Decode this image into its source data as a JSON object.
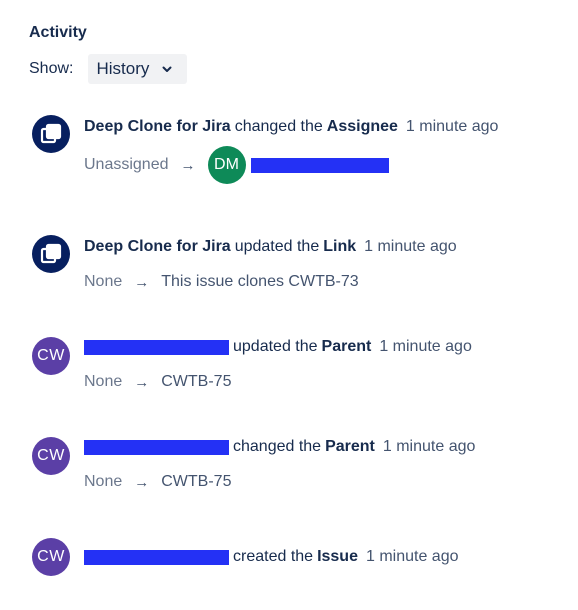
{
  "activity": {
    "heading": "Activity",
    "show_label": "Show:",
    "filter_value": "History"
  },
  "entries": [
    {
      "actor": "Deep Clone for Jira",
      "verb": "changed the",
      "field": "Assignee",
      "time": "1 minute ago",
      "from": "Unassigned",
      "to_avatar": "DM"
    },
    {
      "actor": "Deep Clone for Jira",
      "verb": "updated the",
      "field": "Link",
      "time": "1 minute ago",
      "from": "None",
      "to": "This issue clones CWTB-73"
    },
    {
      "avatar": "CW",
      "verb": "updated the",
      "field": "Parent",
      "time": "1 minute ago",
      "from": "None",
      "to": "CWTB-75"
    },
    {
      "avatar": "CW",
      "verb": "changed the",
      "field": "Parent",
      "time": "1 minute ago",
      "from": "None",
      "to": "CWTB-75"
    },
    {
      "avatar": "CW",
      "verb": "created the",
      "field": "Issue",
      "time": "1 minute ago"
    }
  ],
  "colors": {
    "app_avatar": "#071f5f",
    "user_avatar": "#5b3fa6",
    "assignee_avatar": "#0e8a58",
    "redaction": "#2431f5"
  },
  "icons": {
    "app_avatar": "deep-clone-app-icon",
    "arrow": "arrow-right-icon",
    "dropdown": "chevron-down-icon"
  }
}
